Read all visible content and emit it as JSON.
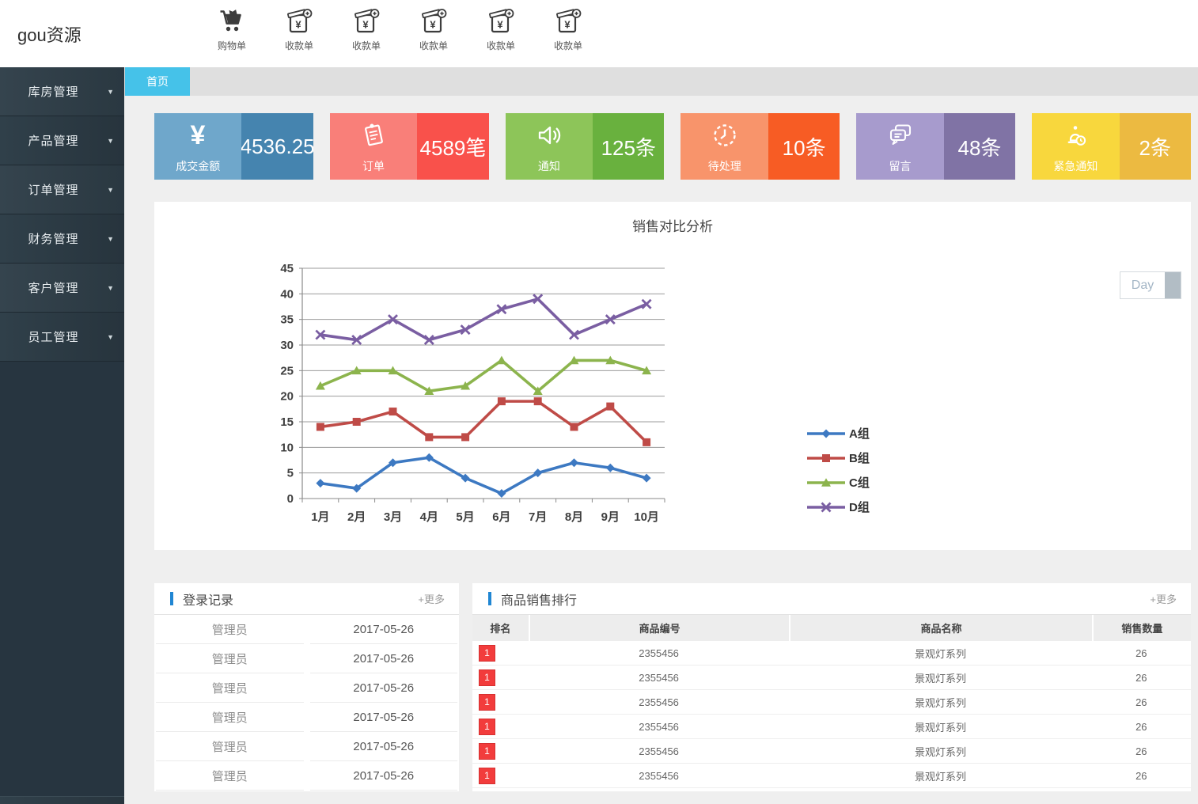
{
  "brand": {
    "logo_text": "gou资源"
  },
  "header": {
    "actions": [
      {
        "label": "购物单",
        "icon": "cart-icon"
      },
      {
        "label": "收款单",
        "icon": "receipt-add-icon"
      },
      {
        "label": "收款单",
        "icon": "receipt-add-icon"
      },
      {
        "label": "收款单",
        "icon": "receipt-add-icon"
      },
      {
        "label": "收款单",
        "icon": "receipt-add-icon"
      },
      {
        "label": "收款单",
        "icon": "receipt-add-icon"
      }
    ]
  },
  "sidebar": {
    "items": [
      {
        "label": "库房管理"
      },
      {
        "label": "产品管理"
      },
      {
        "label": "订单管理"
      },
      {
        "label": "财务管理"
      },
      {
        "label": "客户管理"
      },
      {
        "label": "员工管理"
      }
    ]
  },
  "tabs": {
    "active_label": "首页"
  },
  "stats": [
    {
      "label": "成交金额",
      "value": "4536.25",
      "icon": "yen-icon",
      "color_left": "#6fa7cb",
      "color_right": "#4584af"
    },
    {
      "label": "订单",
      "value": "4589笔",
      "icon": "order-icon",
      "color_left": "#f97f79",
      "color_right": "#f9514b"
    },
    {
      "label": "通知",
      "value": "125条",
      "icon": "speaker-icon",
      "color_left": "#8dc559",
      "color_right": "#69b13e"
    },
    {
      "label": "待处理",
      "value": "10条",
      "icon": "clock-icon",
      "color_left": "#f8946b",
      "color_right": "#f75c24"
    },
    {
      "label": "留言",
      "value": "48条",
      "icon": "message-icon",
      "color_left": "#a79bcd",
      "color_right": "#8073a5"
    },
    {
      "label": "紧急通知",
      "value": "2条",
      "icon": "alarm-clock-icon",
      "color_left": "#f8d73d",
      "color_right": "#ecba41"
    }
  ],
  "chart_panel": {
    "day_button": "Day"
  },
  "chart_data": {
    "type": "line",
    "title": "销售对比分析",
    "categories": [
      "1月",
      "2月",
      "3月",
      "4月",
      "5月",
      "6月",
      "7月",
      "8月",
      "9月",
      "10月"
    ],
    "series": [
      {
        "name": "A组",
        "color": "#3d79c2",
        "marker": "diamond",
        "values": [
          3,
          2,
          7,
          8,
          4,
          1,
          5,
          7,
          6,
          4
        ]
      },
      {
        "name": "B组",
        "color": "#bf4b47",
        "marker": "square",
        "values": [
          14,
          15,
          17,
          12,
          12,
          19,
          19,
          14,
          18,
          11
        ]
      },
      {
        "name": "C组",
        "color": "#8cb44d",
        "marker": "triangle",
        "values": [
          22,
          25,
          25,
          21,
          22,
          27,
          21,
          27,
          27,
          25
        ]
      },
      {
        "name": "D组",
        "color": "#7a5ea2",
        "marker": "x",
        "values": [
          32,
          31,
          35,
          31,
          33,
          37,
          39,
          32,
          35,
          38
        ]
      }
    ],
    "ylim": [
      0,
      45
    ],
    "ytick_step": 5,
    "grid": true,
    "legend_position": "right"
  },
  "login_panel": {
    "title": "登录记录",
    "more_label": "+更多",
    "rows": [
      {
        "user": "管理员",
        "date": "2017-05-26"
      },
      {
        "user": "管理员",
        "date": "2017-05-26"
      },
      {
        "user": "管理员",
        "date": "2017-05-26"
      },
      {
        "user": "管理员",
        "date": "2017-05-26"
      },
      {
        "user": "管理员",
        "date": "2017-05-26"
      },
      {
        "user": "管理员",
        "date": "2017-05-26"
      }
    ]
  },
  "sales_panel": {
    "title": "商品销售排行",
    "more_label": "+更多",
    "columns": [
      "排名",
      "商品编号",
      "商品名称",
      "销售数量"
    ],
    "rows": [
      {
        "rank": "1",
        "code": "2355456",
        "name": "景观灯系列",
        "qty": "26"
      },
      {
        "rank": "1",
        "code": "2355456",
        "name": "景观灯系列",
        "qty": "26"
      },
      {
        "rank": "1",
        "code": "2355456",
        "name": "景观灯系列",
        "qty": "26"
      },
      {
        "rank": "1",
        "code": "2355456",
        "name": "景观灯系列",
        "qty": "26"
      },
      {
        "rank": "1",
        "code": "2355456",
        "name": "景观灯系列",
        "qty": "26"
      },
      {
        "rank": "1",
        "code": "2355456",
        "name": "景观灯系列",
        "qty": "26"
      }
    ]
  }
}
